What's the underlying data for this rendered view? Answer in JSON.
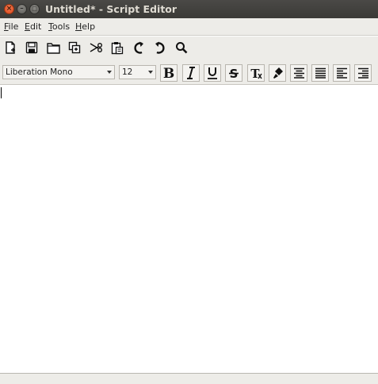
{
  "window": {
    "title": "Untitled* - Script Editor"
  },
  "menubar": {
    "items": [
      {
        "label": "File",
        "mnemonic": "F",
        "rest": "ile"
      },
      {
        "label": "Edit",
        "mnemonic": "E",
        "rest": "dit"
      },
      {
        "label": "Tools",
        "mnemonic": "T",
        "rest": "ools"
      },
      {
        "label": "Help",
        "mnemonic": "H",
        "rest": "elp"
      }
    ]
  },
  "toolbar": {
    "icons": [
      "new-file-icon",
      "save-icon",
      "open-folder-icon",
      "copy-icon",
      "cut-icon",
      "paste-icon",
      "undo-icon",
      "redo-icon",
      "search-icon"
    ]
  },
  "format": {
    "font_family": "Liberation Mono",
    "font_size": "12",
    "icons": [
      "bold-icon",
      "italic-icon",
      "underline-icon",
      "strikethrough-icon",
      "clear-format-icon",
      "paint-brush-icon",
      "align-center-icon",
      "align-justify-icon",
      "align-left-icon",
      "align-right-icon"
    ]
  },
  "editor": {
    "text": ""
  }
}
